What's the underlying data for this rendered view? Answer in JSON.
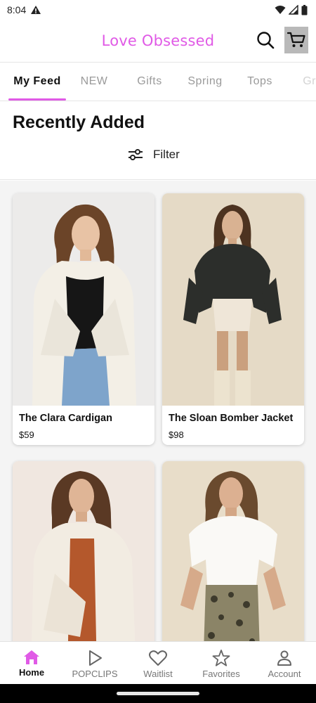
{
  "status_bar": {
    "time": "8:04"
  },
  "app_bar": {
    "title": "Love Obsessed"
  },
  "tabs": [
    {
      "label": "My Feed",
      "active": true
    },
    {
      "label": "NEW"
    },
    {
      "label": "Gifts"
    },
    {
      "label": "Spring"
    },
    {
      "label": "Tops"
    },
    {
      "label": "Gr"
    }
  ],
  "section": {
    "title": "Recently Added",
    "filter_label": "Filter"
  },
  "products": [
    {
      "name": "The Clara Cardigan",
      "price": "$59"
    },
    {
      "name": "The Sloan Bomber Jacket",
      "price": "$98"
    },
    {
      "name": "",
      "price": ""
    },
    {
      "name": "",
      "price": ""
    }
  ],
  "bottom_nav": [
    {
      "label": "Home",
      "icon": "home-icon",
      "active": true
    },
    {
      "label": "POPCLIPS",
      "icon": "play-icon"
    },
    {
      "label": "Waitlist",
      "icon": "heart-icon"
    },
    {
      "label": "Favorites",
      "icon": "star-icon"
    },
    {
      "label": "Account",
      "icon": "account-icon"
    }
  ],
  "colors": {
    "accent": "#e05ae6",
    "grid_background": "#f4f4f4",
    "cart_button": "#b9b9b9"
  }
}
